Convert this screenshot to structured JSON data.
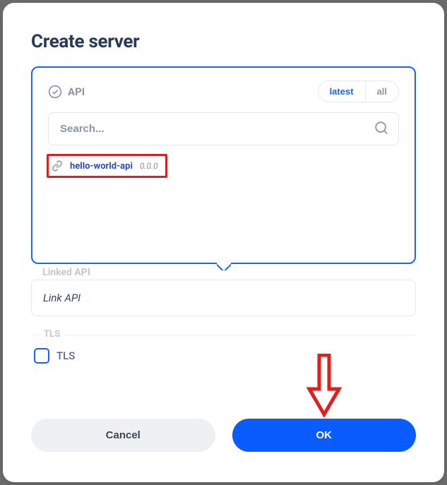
{
  "title": "Create server",
  "dropdown": {
    "label": "API",
    "filters": {
      "latest": "latest",
      "all": "all",
      "active": "latest"
    },
    "search": {
      "placeholder": "Search..."
    },
    "results": [
      {
        "name": "hello-world-api",
        "version": "0.0.0"
      }
    ]
  },
  "linked_api": {
    "label": "Linked API",
    "value": "Link API"
  },
  "tls": {
    "legend": "TLS",
    "label": "TLS",
    "checked": false
  },
  "buttons": {
    "cancel": "Cancel",
    "ok": "OK"
  },
  "annotation": {
    "highlight_result": true,
    "arrow_target": "ok-button",
    "arrow_color": "#e11d1d"
  }
}
